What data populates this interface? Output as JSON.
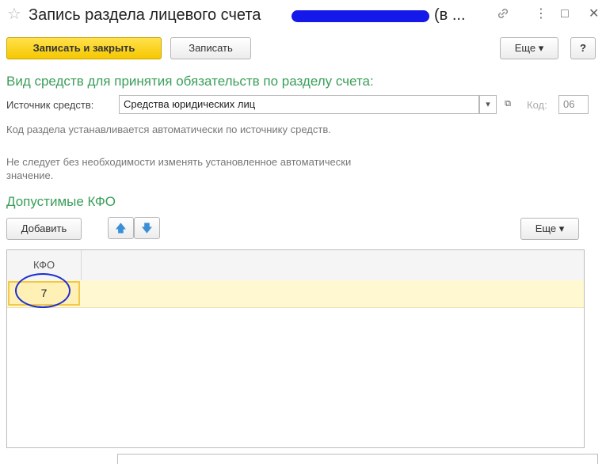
{
  "window": {
    "title": "Запись раздела лицевого счета",
    "title_tail": "(в ...",
    "star_glyph": "☆",
    "link_glyph": "🔗",
    "menu_glyph": "⋮",
    "maximize_glyph": "□",
    "close_glyph": "✕"
  },
  "toolbar": {
    "save_close_label": "Записать и закрыть",
    "save_label": "Записать",
    "more_label": "Еще ▾",
    "help_label": "?"
  },
  "funds_section": {
    "heading": "Вид средств для принятия обязательств по разделу счета:",
    "source_label": "Источник средств:",
    "source_value": "Средства юридических лиц",
    "dropdown_glyph": "▾",
    "open_glyph": "⧉",
    "code_label": "Код:",
    "code_value": "06",
    "hint_line1": "Код раздела устанавливается автоматически по источнику средств.",
    "hint_line2": "Не следует без необходимости изменять установленное автоматически значение."
  },
  "kfo_section": {
    "heading": "Допустимые КФО",
    "add_label": "Добавить",
    "up_glyph": "🡅",
    "down_glyph": "🡇",
    "more_label": "Еще ▾",
    "column_header": "КФО",
    "rows": [
      {
        "kfo": "7"
      }
    ]
  },
  "colors": {
    "accent_green": "#3a9e5a",
    "primary_button": "#f6c800",
    "selected_row": "#fff8d0",
    "annotation_circle": "#1c2ed4",
    "redaction": "#1418e8"
  }
}
